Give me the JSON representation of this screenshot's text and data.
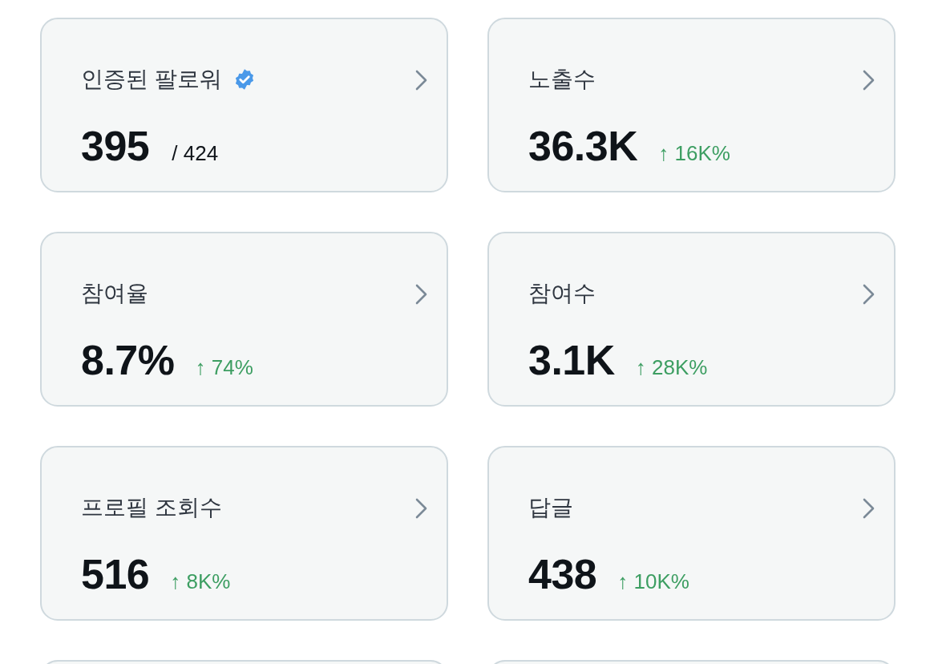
{
  "cards": [
    {
      "kind": "stat",
      "title": "인증된 팔로워",
      "verified": true,
      "value": "395",
      "secondary": {
        "kind": "total",
        "text": "/ 424"
      }
    },
    {
      "kind": "stat",
      "title": "노출수",
      "verified": false,
      "value": "36.3K",
      "secondary": {
        "kind": "change",
        "text": "↑ 16K%"
      }
    },
    {
      "kind": "stat",
      "title": "참여율",
      "verified": false,
      "value": "8.7%",
      "secondary": {
        "kind": "change",
        "text": "↑ 74%"
      }
    },
    {
      "kind": "stat",
      "title": "참여수",
      "verified": false,
      "value": "3.1K",
      "secondary": {
        "kind": "change",
        "text": "↑ 28K%"
      }
    },
    {
      "kind": "stat",
      "title": "프로필 조회수",
      "verified": false,
      "value": "516",
      "secondary": {
        "kind": "change",
        "text": "↑ 8K%"
      }
    },
    {
      "kind": "stat",
      "title": "답글",
      "verified": false,
      "value": "438",
      "secondary": {
        "kind": "change",
        "text": "↑ 10K%"
      }
    },
    {
      "kind": "partial"
    },
    {
      "kind": "partial"
    }
  ]
}
